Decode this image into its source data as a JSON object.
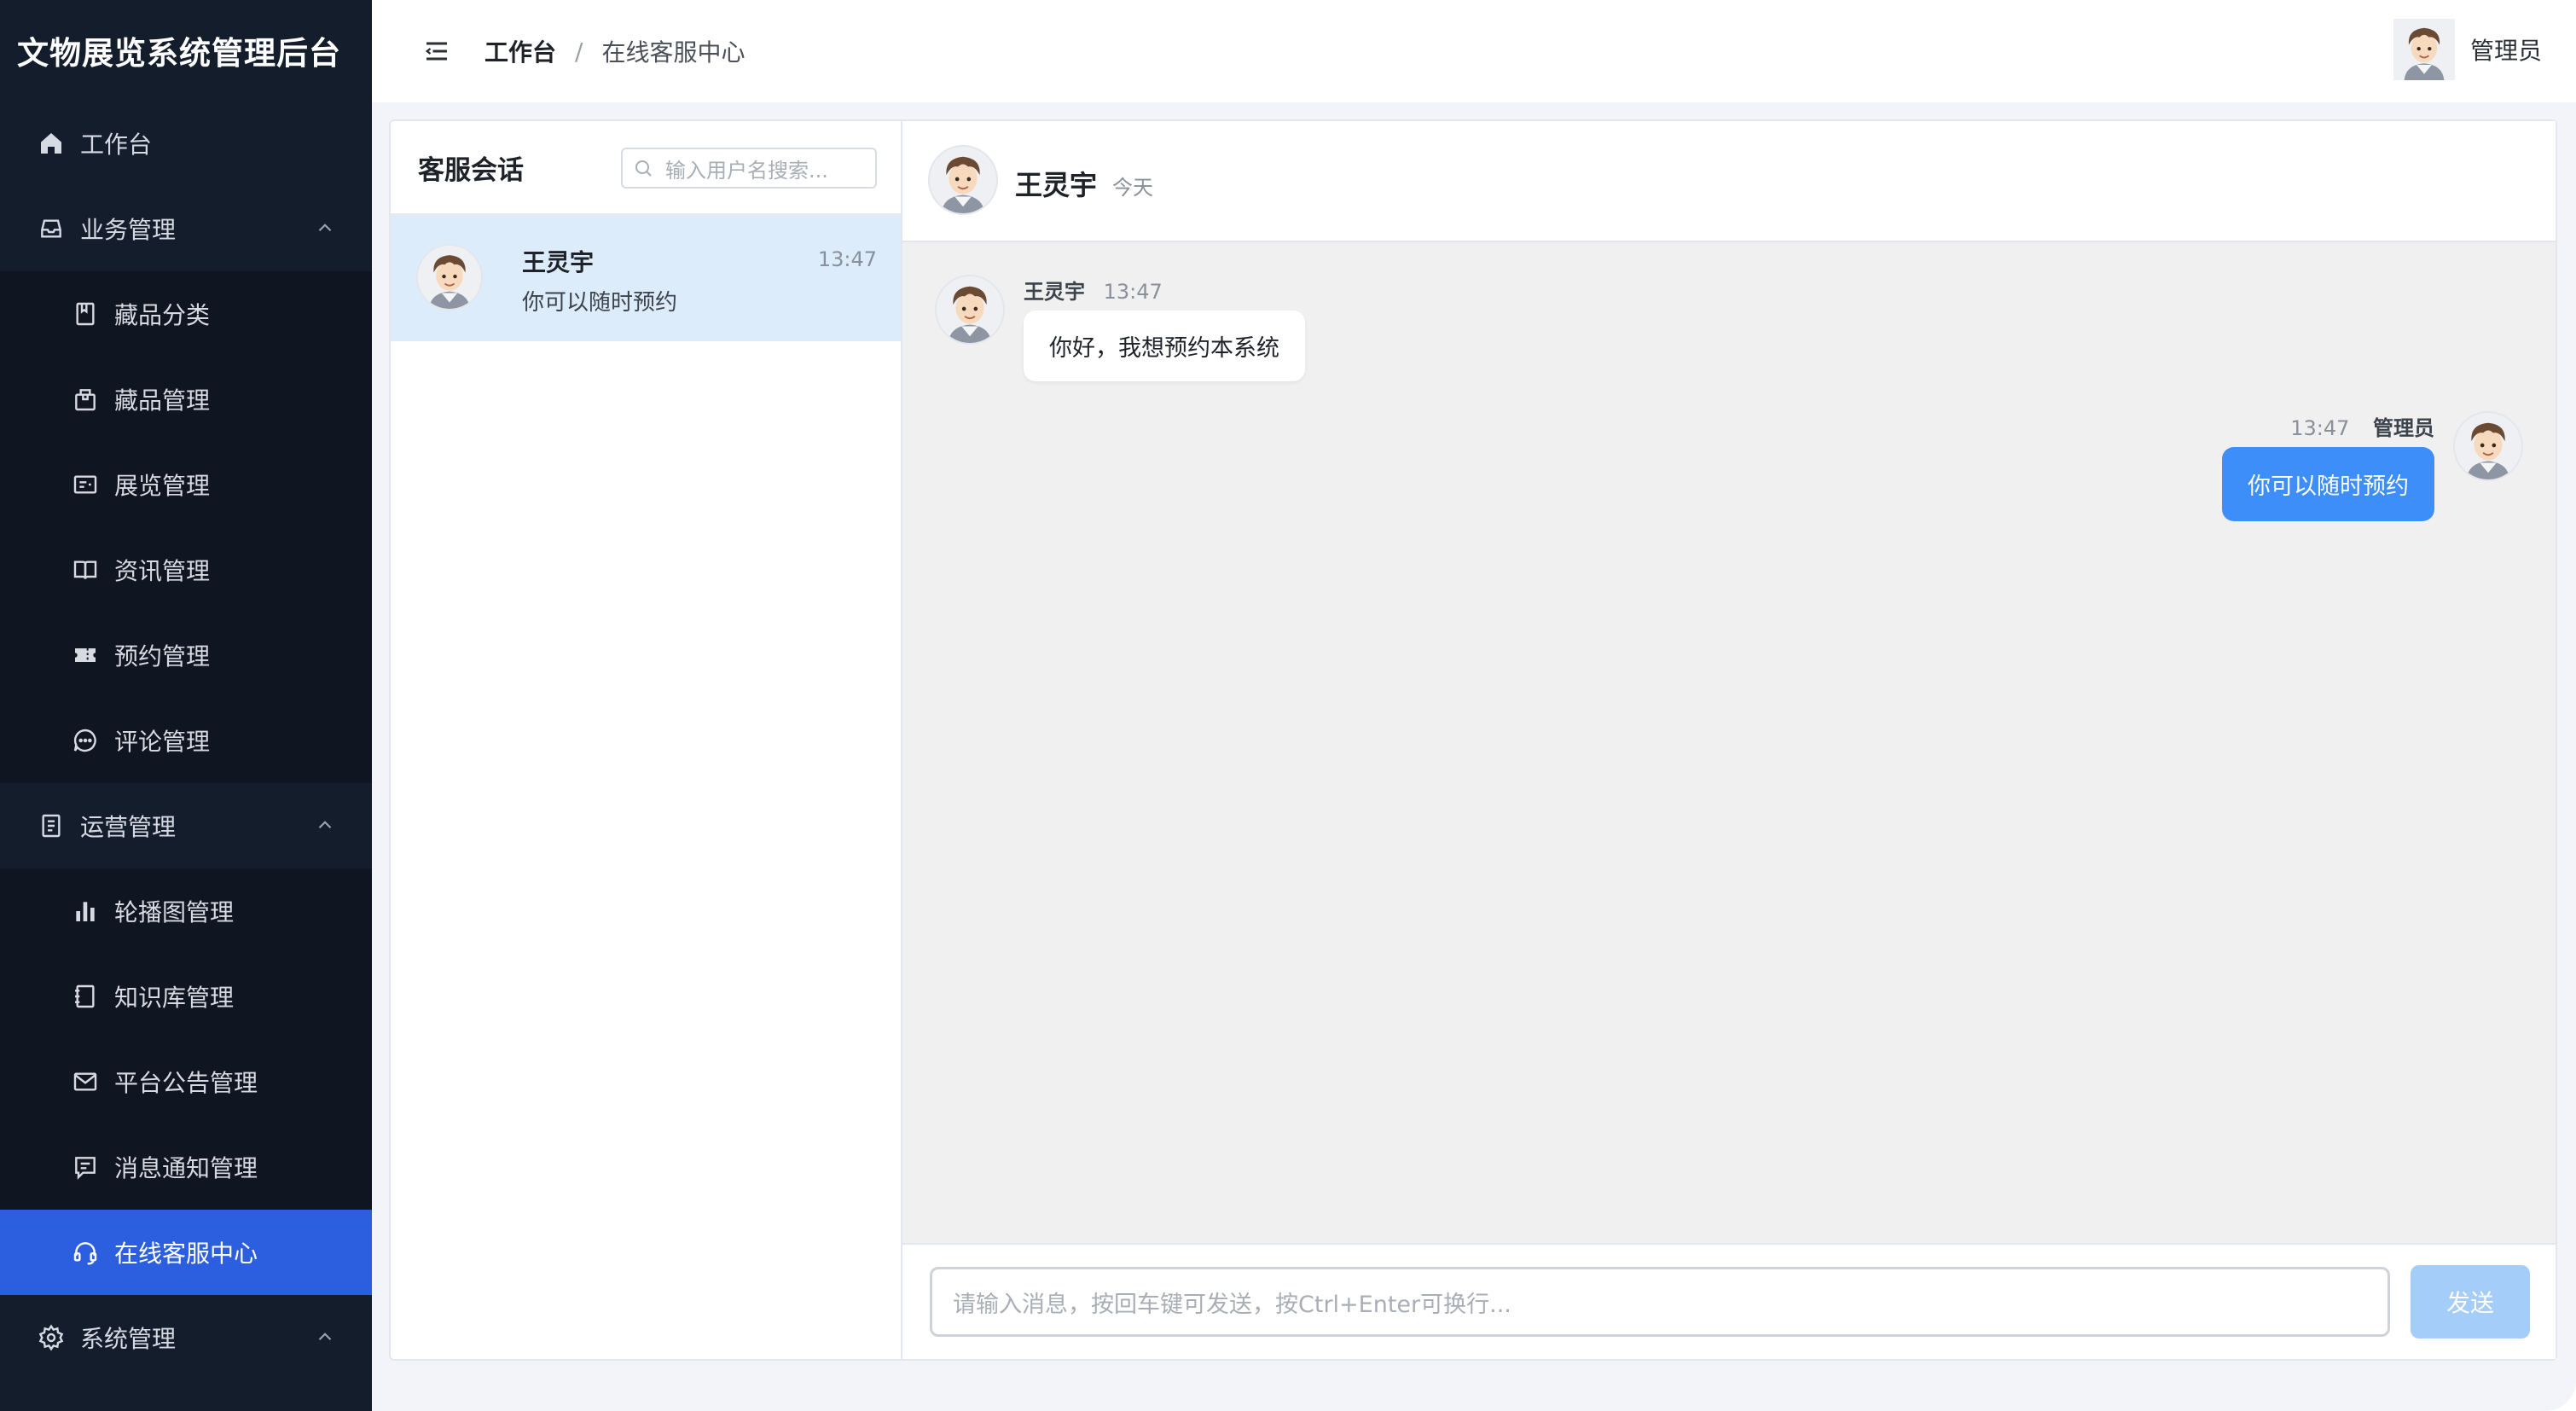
{
  "app": {
    "title": "文物展览系统管理后台",
    "colors": {
      "sidebar": "#141d2c",
      "active": "#2b5fe0",
      "accent": "#3d8ef8",
      "send_disabled": "#a5cdfa"
    }
  },
  "sidebar": {
    "items": [
      {
        "label": "工作台",
        "icon": "home-icon",
        "level": "top"
      },
      {
        "label": "业务管理",
        "icon": "inbox-icon",
        "level": "top",
        "expanded": true
      },
      {
        "label": "藏品分类",
        "icon": "bookmark-icon",
        "level": "sub"
      },
      {
        "label": "藏品管理",
        "icon": "package-icon",
        "level": "sub"
      },
      {
        "label": "展览管理",
        "icon": "card-icon",
        "level": "sub"
      },
      {
        "label": "资讯管理",
        "icon": "open-book-icon",
        "level": "sub"
      },
      {
        "label": "预约管理",
        "icon": "ticket-icon",
        "level": "sub"
      },
      {
        "label": "评论管理",
        "icon": "chat-bubble-icon",
        "level": "sub"
      },
      {
        "label": "运营管理",
        "icon": "document-icon",
        "level": "top",
        "expanded": true
      },
      {
        "label": "轮播图管理",
        "icon": "bar-chart-icon",
        "level": "sub"
      },
      {
        "label": "知识库管理",
        "icon": "notebook-icon",
        "level": "sub"
      },
      {
        "label": "平台公告管理",
        "icon": "mail-icon",
        "level": "sub"
      },
      {
        "label": "消息通知管理",
        "icon": "message-icon",
        "level": "sub"
      },
      {
        "label": "在线客服中心",
        "icon": "headset-icon",
        "level": "sub",
        "active": true
      },
      {
        "label": "系统管理",
        "icon": "gear-icon",
        "level": "top",
        "expanded": true
      }
    ]
  },
  "header": {
    "breadcrumb": {
      "home": "工作台",
      "separator": "/",
      "current": "在线客服中心"
    },
    "user": {
      "name": "管理员"
    }
  },
  "conversations": {
    "title": "客服会话",
    "search": {
      "placeholder": "输入用户名搜索..."
    },
    "items": [
      {
        "name": "王灵宇",
        "time": "13:47",
        "last_message": "你可以随时预约",
        "selected": true
      }
    ]
  },
  "chat": {
    "header": {
      "name": "王灵宇",
      "subtitle": "今天"
    },
    "messages": [
      {
        "direction": "in",
        "sender": "王灵宇",
        "time": "13:47",
        "text": "你好，我想预约本系统"
      },
      {
        "direction": "out",
        "sender": "管理员",
        "time": "13:47",
        "text": "你可以随时预约"
      }
    ],
    "input": {
      "placeholder": "请输入消息，按回车键可发送，按Ctrl+Enter可换行..."
    },
    "send_label": "发送"
  }
}
